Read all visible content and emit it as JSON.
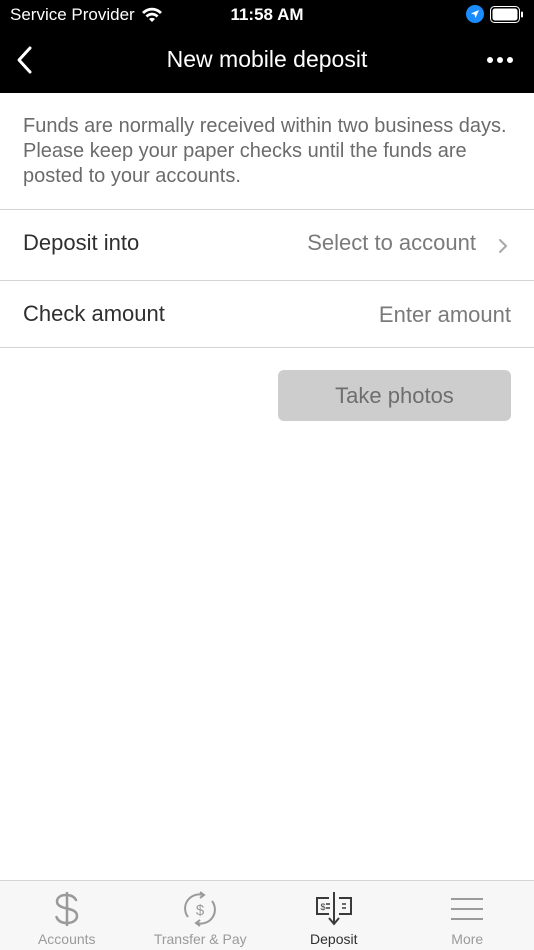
{
  "status_bar": {
    "carrier": "Service Provider",
    "time": "11:58 AM"
  },
  "nav": {
    "title": "New mobile deposit"
  },
  "info_text": "Funds are normally received within two business days. Please keep your paper checks until the funds are posted to your accounts.",
  "form": {
    "deposit_into": {
      "label": "Deposit into",
      "value": "Select to account"
    },
    "check_amount": {
      "label": "Check amount",
      "placeholder": "Enter amount"
    }
  },
  "take_photos_label": "Take photos",
  "tabs": [
    {
      "label": "Accounts",
      "icon": "dollar-icon",
      "active": false
    },
    {
      "label": "Transfer & Pay",
      "icon": "transfer-pay-icon",
      "active": false
    },
    {
      "label": "Deposit",
      "icon": "deposit-check-icon",
      "active": true
    },
    {
      "label": "More",
      "icon": "menu-icon",
      "active": false
    }
  ]
}
